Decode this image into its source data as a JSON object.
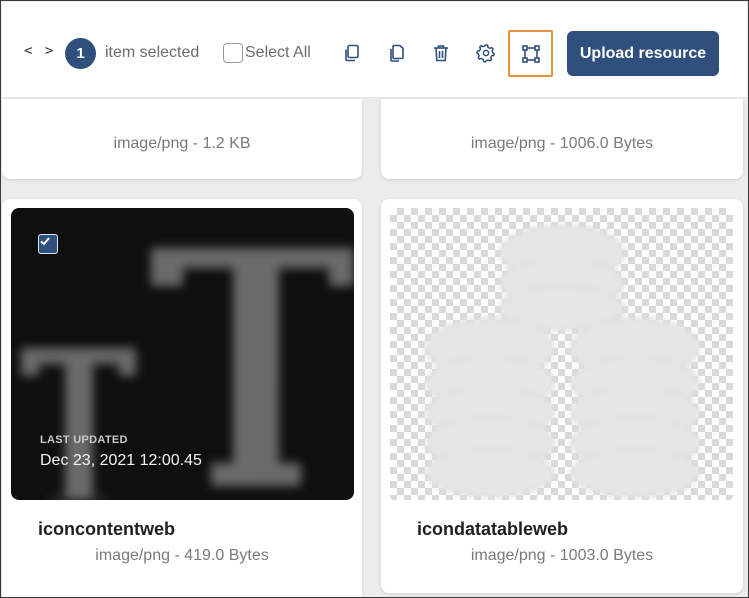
{
  "toolbar": {
    "nav_arrows": "< >",
    "selected_count": "1",
    "selected_label": "item selected",
    "select_all_label": "Select All",
    "upload_label": "Upload resource",
    "icons": [
      "copy-icon",
      "duplicate-icon",
      "trash-icon",
      "gear-icon",
      "crop-frame-icon"
    ],
    "accent_color": "#2f4f7c",
    "focus_color": "#e8913a"
  },
  "cards": {
    "top_left": {
      "meta": "image/png - 1.2 KB"
    },
    "top_right": {
      "meta": "image/png - 1006.0 Bytes"
    },
    "bottom_left": {
      "name": "iconcontentweb",
      "meta": "image/png - 419.0 Bytes",
      "last_updated_label": "LAST UPDATED",
      "last_updated_value": "Dec 23, 2021 12:00.45",
      "selected": true
    },
    "bottom_right": {
      "name": "icondatatableweb",
      "meta": "image/png - 1003.0 Bytes"
    }
  }
}
